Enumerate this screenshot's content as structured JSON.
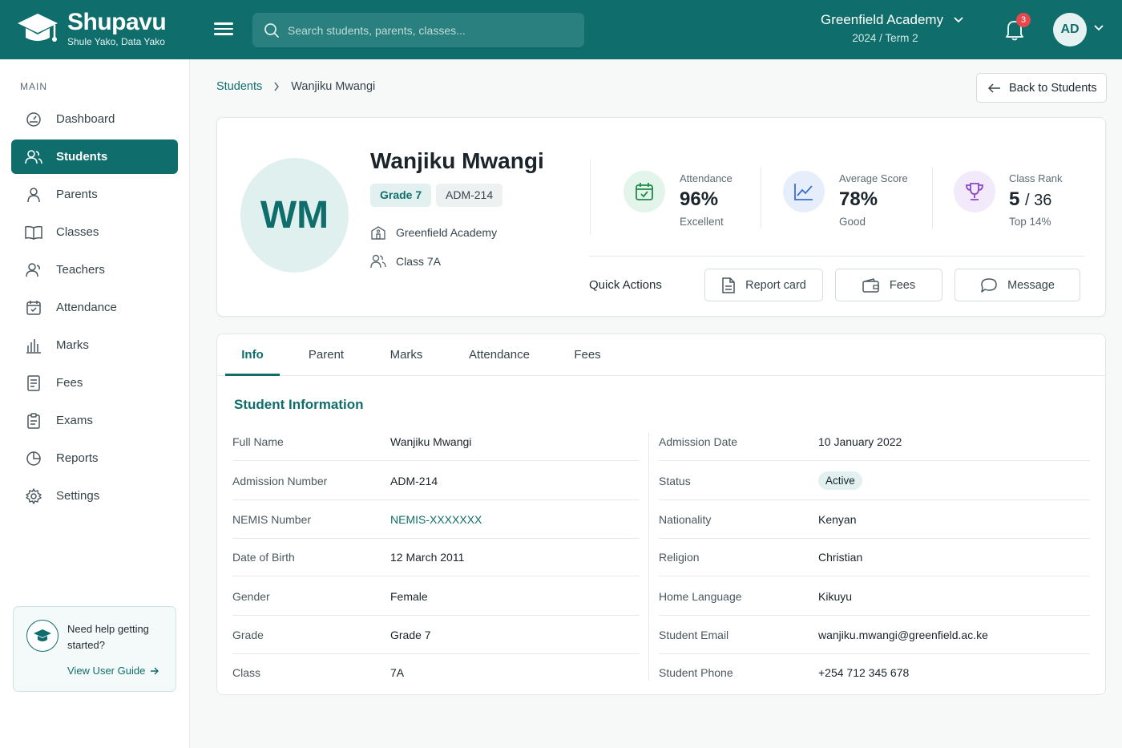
{
  "brand": {
    "name": "Shupavu",
    "tagline": "Shule Yako, Data Yako"
  },
  "search": {
    "placeholder": "Search students, parents, classes..."
  },
  "school": {
    "name": "Greenfield Academy",
    "term": "2024 / Term 2"
  },
  "notifications": {
    "count": "3"
  },
  "user": {
    "initials": "AD"
  },
  "sidebar": {
    "section": "MAIN",
    "items": [
      {
        "label": "Dashboard",
        "icon": "dashboard-icon"
      },
      {
        "label": "Students",
        "icon": "students-icon",
        "active": true
      },
      {
        "label": "Parents",
        "icon": "parent-icon"
      },
      {
        "label": "Classes",
        "icon": "book-icon"
      },
      {
        "label": "Teachers",
        "icon": "teachers-icon"
      },
      {
        "label": "Attendance",
        "icon": "calendar-check-icon"
      },
      {
        "label": "Marks",
        "icon": "bar-chart-icon"
      },
      {
        "label": "Fees",
        "icon": "receipt-icon"
      },
      {
        "label": "Exams",
        "icon": "clipboard-icon"
      },
      {
        "label": "Reports",
        "icon": "pie-chart-icon"
      },
      {
        "label": "Settings",
        "icon": "gear-icon"
      }
    ],
    "help": {
      "text": "Need help getting started?",
      "link": "View User Guide"
    }
  },
  "breadcrumb": {
    "parent": "Students",
    "current": "Wanjiku Mwangi"
  },
  "back_button": "Back to Students",
  "profile": {
    "initials": "WM",
    "name": "Wanjiku Mwangi",
    "grade": "Grade 7",
    "admission": "ADM-214",
    "school": "Greenfield Academy",
    "class": "Class 7A"
  },
  "stats": {
    "attendance": {
      "label": "Attendance",
      "value": "96%",
      "sub": "Excellent"
    },
    "average": {
      "label": "Average Score",
      "value": "78%",
      "sub": "Good"
    },
    "rank": {
      "label": "Class Rank",
      "value": "5",
      "total": "/ 36",
      "sub": "Top 14%"
    }
  },
  "quick_actions": {
    "title": "Quick Actions",
    "report_card": "Report card",
    "fees": "Fees",
    "message": "Message"
  },
  "tabs": [
    "Info",
    "Parent",
    "Marks",
    "Attendance",
    "Fees"
  ],
  "info": {
    "title": "Student Information",
    "left": [
      {
        "label": "Full Name",
        "value": "Wanjiku Mwangi"
      },
      {
        "label": "Admission Number",
        "value": "ADM-214"
      },
      {
        "label": "NEMIS Number",
        "value": "NEMIS-XXXXXXX"
      },
      {
        "label": "Date of Birth",
        "value": "12 March 2011"
      },
      {
        "label": "Gender",
        "value": "Female"
      },
      {
        "label": "Grade",
        "value": "Grade 7"
      },
      {
        "label": "Class",
        "value": "7A"
      }
    ],
    "right": [
      {
        "label": "Admission Date",
        "value": "10 January 2022"
      },
      {
        "label": "Status",
        "value": "Active"
      },
      {
        "label": "Nationality",
        "value": "Kenyan"
      },
      {
        "label": "Religion",
        "value": "Christian"
      },
      {
        "label": "Home Language",
        "value": "Kikuyu"
      },
      {
        "label": "Student Email",
        "value": "wanjiku.mwangi@greenfield.ac.ke"
      },
      {
        "label": "Student Phone",
        "value": "+254 712 345 678"
      }
    ]
  },
  "colors": {
    "brand": "#0f6e6c",
    "attendance_icon_bg": "#e3f4ea",
    "score_icon_bg": "#e6eefb",
    "rank_icon_bg": "#f2e9fb"
  }
}
